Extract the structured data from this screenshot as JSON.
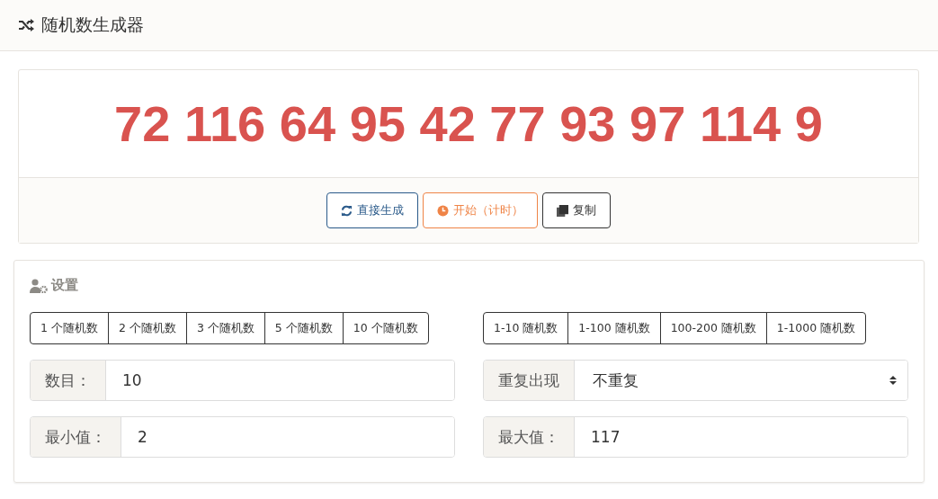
{
  "header": {
    "title": "随机数生成器"
  },
  "result": {
    "numbers": "72 116 64 95 42 77 93 97 114 9"
  },
  "actions": [
    {
      "label": "直接生成",
      "kind": "refresh"
    },
    {
      "label": "开始（计时）",
      "kind": "timer"
    },
    {
      "label": "复制",
      "kind": "copy"
    }
  ],
  "settings": {
    "title": "设置",
    "count_presets": [
      "1 个随机数",
      "2 个随机数",
      "3 个随机数",
      "5 个随机数",
      "10 个随机数"
    ],
    "range_presets": [
      "1-10 随机数",
      "1-100 随机数",
      "100-200 随机数",
      "1-1000 随机数"
    ],
    "fields": [
      {
        "label": "数目：",
        "kind": "input",
        "value": "10"
      },
      {
        "label": "重复出现",
        "kind": "select",
        "value": "不重复"
      },
      {
        "label": "最小值：",
        "kind": "input",
        "value": "2"
      },
      {
        "label": "最大值：",
        "kind": "input",
        "value": "117"
      }
    ]
  }
}
